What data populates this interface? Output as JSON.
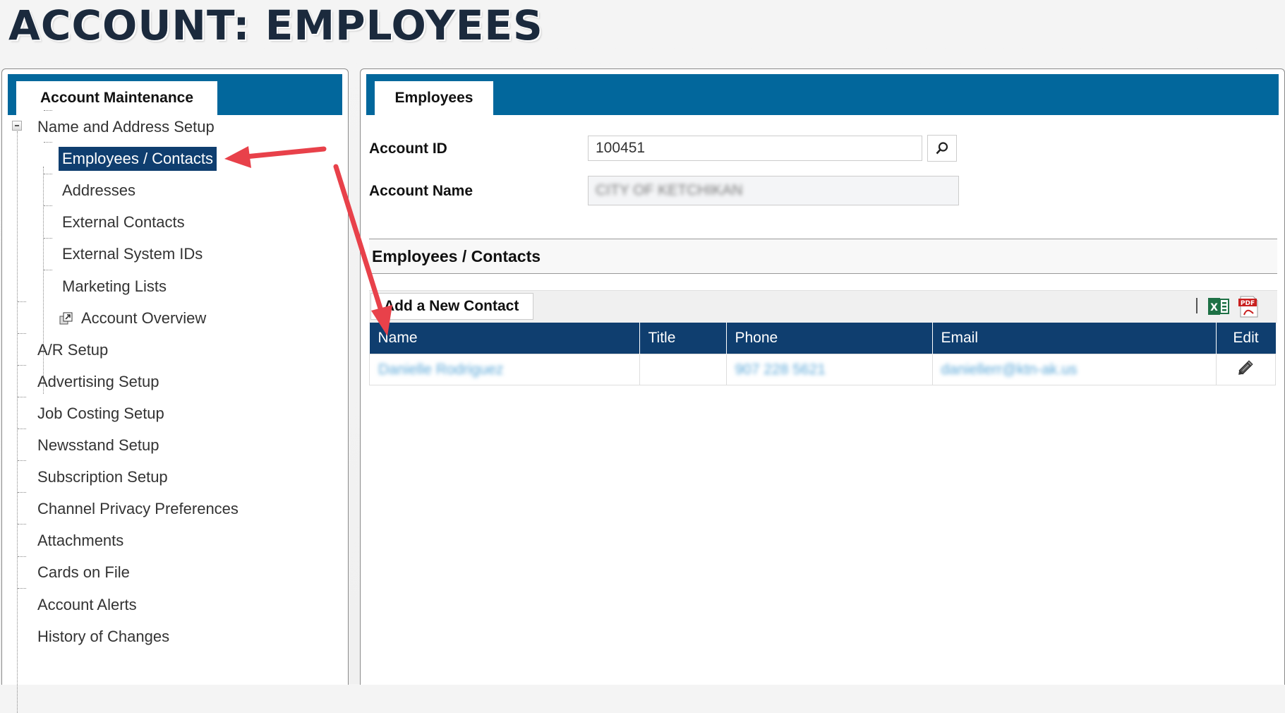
{
  "page": {
    "title": "ACCOUNT: EMPLOYEES"
  },
  "left_panel": {
    "tab_label": "Account Maintenance",
    "tree": [
      {
        "label": "Name and Address Setup",
        "level": 0,
        "expanded": true
      },
      {
        "label": "Employees / Contacts",
        "level": 1,
        "selected": true
      },
      {
        "label": "Addresses",
        "level": 1
      },
      {
        "label": "External Contacts",
        "level": 1
      },
      {
        "label": "External System IDs",
        "level": 1
      },
      {
        "label": "Marketing Lists",
        "level": 1
      },
      {
        "label": "Account Overview",
        "level": 1,
        "icon": "external-link-icon"
      },
      {
        "label": "A/R Setup",
        "level": 0
      },
      {
        "label": "Advertising Setup",
        "level": 0
      },
      {
        "label": "Job Costing Setup",
        "level": 0
      },
      {
        "label": "Newsstand Setup",
        "level": 0
      },
      {
        "label": "Subscription Setup",
        "level": 0
      },
      {
        "label": "Channel Privacy Preferences",
        "level": 0
      },
      {
        "label": "Attachments",
        "level": 0
      },
      {
        "label": "Cards on File",
        "level": 0
      },
      {
        "label": "Account Alerts",
        "level": 0
      },
      {
        "label": "History of Changes",
        "level": 0
      }
    ]
  },
  "right_panel": {
    "tab_label": "Employees",
    "form": {
      "account_id_label": "Account ID",
      "account_id_value": "100451",
      "account_name_label": "Account Name",
      "account_name_value": "CITY OF KETCHIKAN"
    },
    "section_title": "Employees / Contacts",
    "toolbar": {
      "add_button": "Add a New Contact",
      "export_icons": [
        "excel-export-icon",
        "pdf-export-icon"
      ]
    },
    "table": {
      "columns": [
        "Name",
        "Title",
        "Phone",
        "Email",
        "Edit"
      ],
      "rows": [
        {
          "name": "Danielle Rodriguez",
          "title": "",
          "phone": "907 228 5621",
          "email": "daniellerr@ktn-ak.us",
          "edit_icon": "pencil-icon"
        }
      ]
    }
  },
  "annotations": {
    "color": "#e8414a",
    "arrows": 2
  }
}
